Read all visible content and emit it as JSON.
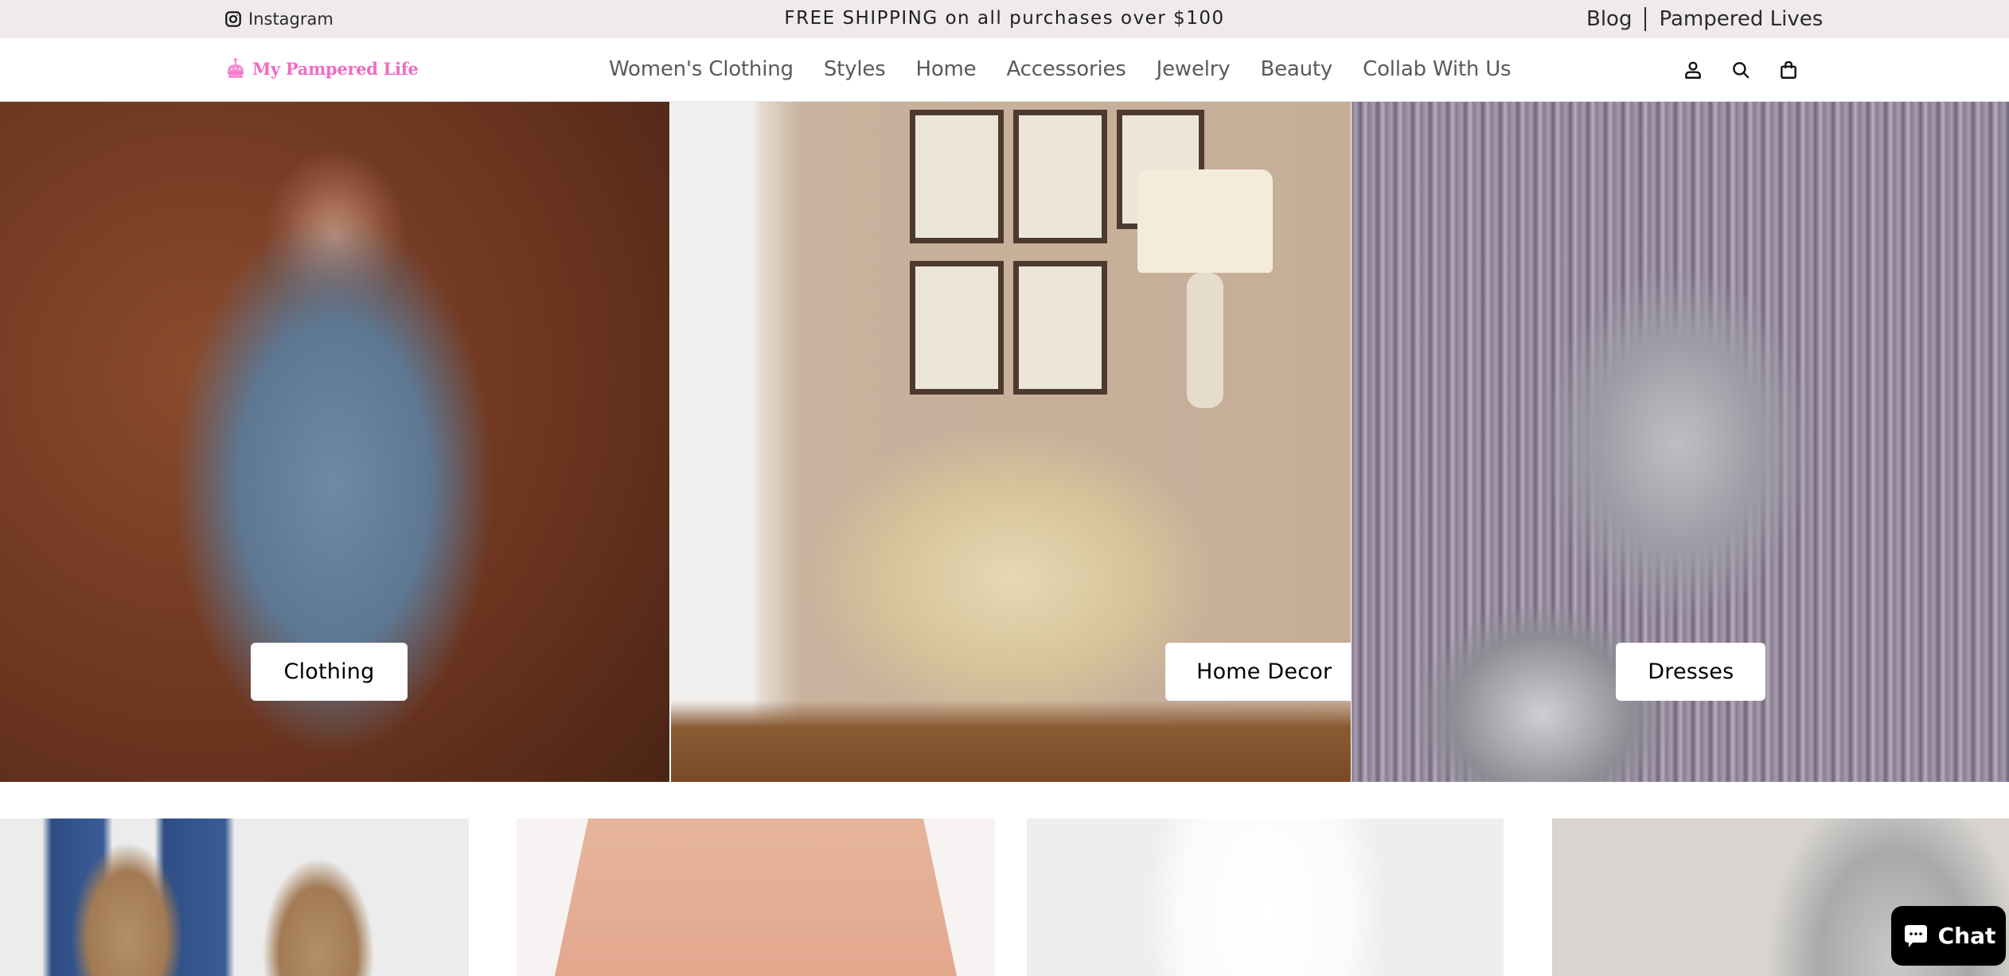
{
  "announcement": {
    "instagram_label": "Instagram",
    "message": "FREE SHIPPING on all purchases over $100",
    "links": [
      {
        "label": "Blog"
      },
      {
        "label": "Pampered Lives"
      }
    ]
  },
  "header": {
    "logo_text": "My Pampered Life",
    "logo_icon": "crown-icon",
    "brand_color": "#f06cc4",
    "nav": [
      {
        "label": "Women's Clothing"
      },
      {
        "label": "Styles"
      },
      {
        "label": "Home"
      },
      {
        "label": "Accessories"
      },
      {
        "label": "Jewelry"
      },
      {
        "label": "Beauty"
      },
      {
        "label": "Collab With Us"
      }
    ],
    "icons": [
      "account-icon",
      "search-icon",
      "cart-icon"
    ]
  },
  "hero": {
    "panels": [
      {
        "button_label": "Clothing",
        "image": "woman-in-denim-dress"
      },
      {
        "button_label": "Home Decor",
        "image": "console-table-with-botanical-prints"
      },
      {
        "button_label": "Dresses",
        "image": "woman-in-sequin-dress"
      }
    ]
  },
  "products": [
    {
      "image": "lace-up-suede-boots"
    },
    {
      "image": "paperclip-chain-necklace"
    },
    {
      "image": "white-button-up-shirt"
    },
    {
      "image": "plaid-fuzzy-jacket"
    }
  ],
  "chat": {
    "label": "Chat"
  }
}
